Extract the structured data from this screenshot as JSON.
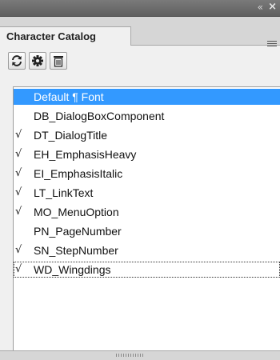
{
  "window": {
    "collapse_glyph": "«",
    "close_glyph": "×"
  },
  "panel": {
    "tab_label": "Character Catalog",
    "menu_icon": "panel-menu-icon"
  },
  "toolbar": {
    "buttons": [
      {
        "name": "refresh-icon"
      },
      {
        "name": "settings-icon"
      },
      {
        "name": "delete-icon"
      }
    ]
  },
  "styles": [
    {
      "label": "Default ¶ Font",
      "check": "",
      "selected": true
    },
    {
      "label": "DB_DialogBoxComponent",
      "check": ""
    },
    {
      "label": "DT_DialogTitle",
      "check": "√"
    },
    {
      "label": "EH_EmphasisHeavy",
      "check": "√"
    },
    {
      "label": "EI_EmphasisItalic",
      "check": "√"
    },
    {
      "label": "LT_LinkText",
      "check": "√"
    },
    {
      "label": "MO_MenuOption",
      "check": "√"
    },
    {
      "label": "PN_PageNumber",
      "check": ""
    },
    {
      "label": "SN_StepNumber",
      "check": "√"
    },
    {
      "label": "WD_Wingdings",
      "check": "√",
      "focused": true
    }
  ],
  "colors": {
    "selection": "#3399ff",
    "titlebar": "#666666",
    "panel_bg": "#f0f0f0"
  }
}
